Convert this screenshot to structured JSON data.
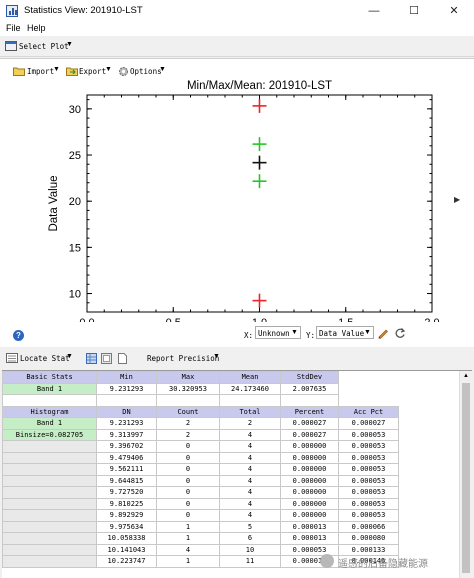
{
  "window": {
    "title": "Statistics View: 201910-LST",
    "min_glyph": "—",
    "max_glyph": "☐",
    "close_glyph": "✕"
  },
  "menubar": {
    "file": "File",
    "help": "Help"
  },
  "toolbar1": {
    "select_plot": "Select Plot"
  },
  "plot_toolbar": {
    "import": "Import",
    "export": "Export",
    "options": "Options"
  },
  "chart_data": {
    "type": "scatter",
    "title": "Min/Max/Mean: 201910-LST",
    "xlabel": "Unknown",
    "ylabel": "Data Value",
    "xlim": [
      0.0,
      2.0
    ],
    "ylim": [
      8.0,
      31.5
    ],
    "x_ticks": [
      "0.0",
      "0.5",
      "1.0",
      "1.5",
      "2.0"
    ],
    "y_ticks": [
      "10",
      "15",
      "20",
      "25",
      "30"
    ],
    "marker": "plus",
    "series": [
      {
        "points": [
          [
            1.0,
            30.320953
          ],
          [
            1.0,
            9.231293
          ]
        ],
        "color": "#e8262a"
      },
      {
        "points": [
          [
            1.0,
            24.17346
          ]
        ],
        "color": "#111111"
      },
      {
        "points": [
          [
            1.0,
            26.181095
          ],
          [
            1.0,
            22.165825
          ]
        ],
        "color": "#27c427"
      }
    ]
  },
  "axis_controls": {
    "x_prefix": "X:",
    "x_value": "Unknown",
    "y_prefix": "Y:",
    "y_value": "Data Value",
    "help_glyph": "?"
  },
  "toolbar2": {
    "locate_stat": "Locate Stat",
    "report_precision": "Report Precision"
  },
  "basic_stats": {
    "headers": [
      "Basic Stats",
      "Min",
      "Max",
      "Mean",
      "StdDev"
    ],
    "rows": [
      [
        "Band 1",
        "9.231293",
        "30.320953",
        "24.173460",
        "2.007635"
      ]
    ]
  },
  "histogram": {
    "headers": [
      "Histogram",
      "DN",
      "Count",
      "Total",
      "Percent",
      "Acc Pct"
    ],
    "labels": [
      "Band 1",
      "Binsize=0.082705"
    ],
    "rows": [
      [
        "9.231293",
        "2",
        "2",
        "0.000027",
        "0.000027"
      ],
      [
        "9.313997",
        "2",
        "4",
        "0.000027",
        "0.000053"
      ],
      [
        "9.396702",
        "0",
        "4",
        "0.000000",
        "0.000053"
      ],
      [
        "9.479406",
        "0",
        "4",
        "0.000000",
        "0.000053"
      ],
      [
        "9.562111",
        "0",
        "4",
        "0.000000",
        "0.000053"
      ],
      [
        "9.644815",
        "0",
        "4",
        "0.000000",
        "0.000053"
      ],
      [
        "9.727520",
        "0",
        "4",
        "0.000000",
        "0.000053"
      ],
      [
        "9.810225",
        "0",
        "4",
        "0.000000",
        "0.000053"
      ],
      [
        "9.892929",
        "0",
        "4",
        "0.000000",
        "0.000053"
      ],
      [
        "9.975634",
        "1",
        "5",
        "0.000013",
        "0.000066"
      ],
      [
        "10.058338",
        "1",
        "6",
        "0.000013",
        "0.000080"
      ],
      [
        "10.141043",
        "4",
        "10",
        "0.000053",
        "0.000133"
      ],
      [
        "10.223747",
        "1",
        "11",
        "0.000013",
        "0.000146"
      ]
    ]
  },
  "watermark": "遥感的后备隐藏能源"
}
